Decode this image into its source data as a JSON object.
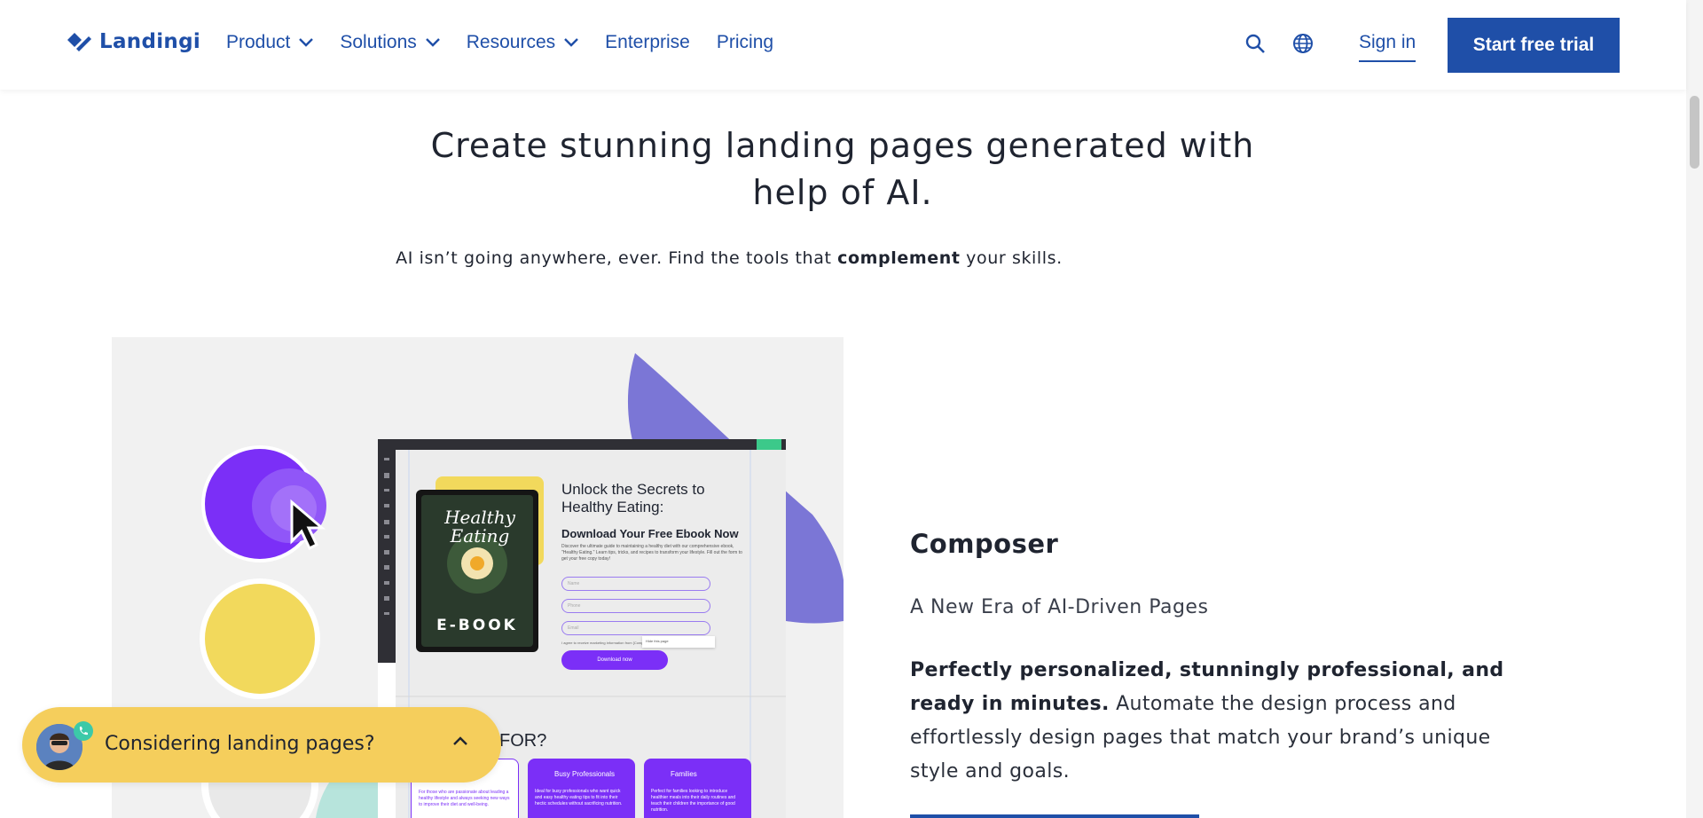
{
  "header": {
    "logo_text": "Landingi",
    "nav": [
      {
        "label": "Product",
        "dropdown": true
      },
      {
        "label": "Solutions",
        "dropdown": true
      },
      {
        "label": "Resources",
        "dropdown": true
      },
      {
        "label": "Enterprise",
        "dropdown": false
      },
      {
        "label": "Pricing",
        "dropdown": false
      }
    ],
    "search_icon": "search-icon",
    "language_icon": "globe-icon",
    "signin_label": "Sign in",
    "cta_label": "Start free trial"
  },
  "hero": {
    "title": "Create stunning landing pages generated with help of AI.",
    "subtitle_pre": "AI isn’t going anywhere, ever. Find the tools that ",
    "subtitle_bold": "complement",
    "subtitle_post": " your skills."
  },
  "feature": {
    "title": "Composer",
    "subtitle": "A New Era of AI-Driven Pages",
    "body_bold": "Perfectly personalized, stunningly professional, and ready in minutes.",
    "body_rest": " Automate the design process and effortlessly design pages that match your brand’s unique style and goals."
  },
  "mockup": {
    "book_title_1": "Healthy",
    "book_title_2": "Eating",
    "book_label": "E-BOOK",
    "headline": "Unlock the Secrets to Healthy Eating:",
    "subheadline": "Download Your Free Ebook Now",
    "description": "Discover the ultimate guide to maintaining a healthy diet with our comprehensive ebook, \"Healthy Eating.\" Learn tips, tricks, and recipes to transform your lifestyle. Fill out the form to get your free copy today!",
    "input_placeholders": [
      "Name",
      "Phone",
      "Email"
    ],
    "checkbox_text": "I agree to receive marketing information from [Company]",
    "tooltip_text": "Hide this page",
    "button_label": "Download now",
    "section_heading": "FOR?",
    "cards": [
      {
        "title": "Busy Professionals",
        "text": "Ideal for busy professionals who want quick and easy healthy eating tips to fit into their hectic schedules without sacrificing nutrition."
      },
      {
        "title": "Families",
        "text": "Perfect for families looking to introduce healthier meals into their daily routines and teach their children the importance of good nutrition."
      }
    ],
    "left_card_text": "For those who are passionate about leading a healthy lifestyle and always seeking new ways to improve their diet and well-being."
  },
  "chat": {
    "label": "Considering landing pages?"
  },
  "colors": {
    "brand": "#1f4fa8",
    "chat_bg": "#f5ce5c",
    "purple": "#7b2ff7",
    "yellow": "#f2d95c",
    "lavender": "#7b76d6"
  }
}
